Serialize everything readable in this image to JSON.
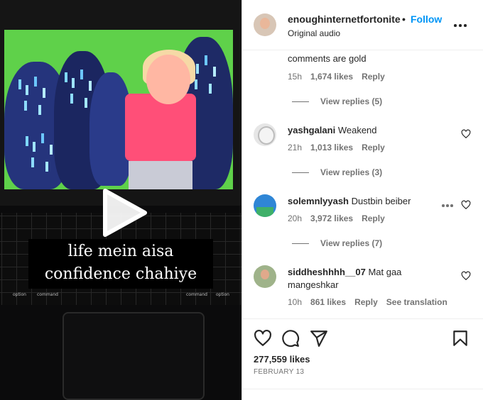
{
  "video": {
    "caption_line1": "life mein aisa",
    "caption_line2": "confidence chahiye",
    "keys": [
      "option",
      "command",
      "command",
      "option"
    ]
  },
  "post_header": {
    "username": "enoughinternetfortonite",
    "separator": "•",
    "follow_label": "Follow",
    "subtitle": "Original audio"
  },
  "comments": [
    {
      "username": "",
      "text": "comments are gold",
      "time": "15h",
      "likes": "1,674 likes",
      "reply": "Reply",
      "view_replies": "View replies (5)"
    },
    {
      "username": "yashgalani",
      "text": "Weakend",
      "time": "21h",
      "likes": "1,013 likes",
      "reply": "Reply",
      "view_replies": "View replies (3)"
    },
    {
      "username": "solemnlyyash",
      "text": "Dustbin beiber",
      "time": "20h",
      "likes": "3,972 likes",
      "reply": "Reply",
      "view_replies": "View replies (7)"
    },
    {
      "username": "siddheshhhh__07",
      "text": "Mat gaa",
      "text_line2": "mangeshkar",
      "time": "10h",
      "likes": "861 likes",
      "reply": "Reply",
      "see_translation": "See translation"
    }
  ],
  "post_footer": {
    "likes": "277,559 likes",
    "date": "FEBRUARY 13"
  },
  "icons": {
    "like": "heart-icon",
    "comment": "comment-bubble-icon",
    "share": "paper-plane-icon",
    "save": "bookmark-icon",
    "more": "more-horizontal-icon",
    "play": "play-icon"
  },
  "colors": {
    "accent": "#0095f6",
    "text_primary": "#262626",
    "text_secondary": "#737373",
    "border": "#dbdbdb"
  }
}
